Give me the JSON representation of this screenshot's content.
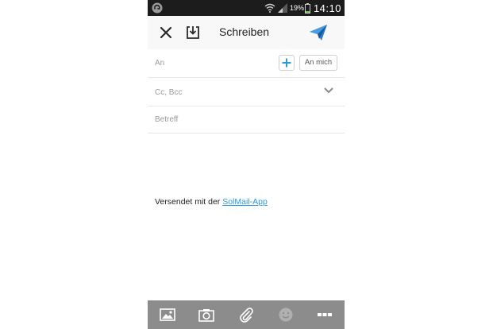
{
  "statusbar": {
    "battery_percent": "19%",
    "time": "14:10",
    "icons": [
      "app-icon",
      "wifi-icon",
      "signal-icon",
      "battery-icon"
    ]
  },
  "actionbar": {
    "title": "Schreiben",
    "icons": [
      "close-icon",
      "save-draft-icon",
      "send-icon"
    ],
    "accent_color": "#2a7fd0"
  },
  "compose": {
    "to_label": "An",
    "to_me_label": "An mich",
    "cc_label": "Cc, Bcc",
    "subject_label": "Betreff"
  },
  "body": {
    "signature_prefix": "Versendet mit der ",
    "signature_link": "SolMail-App",
    "link_color": "#2a9bd6"
  },
  "toolbar": {
    "icons": [
      "image-icon",
      "camera-icon",
      "attachment-icon",
      "emoji-icon",
      "more-icon"
    ],
    "background": "#8c8c8c"
  }
}
